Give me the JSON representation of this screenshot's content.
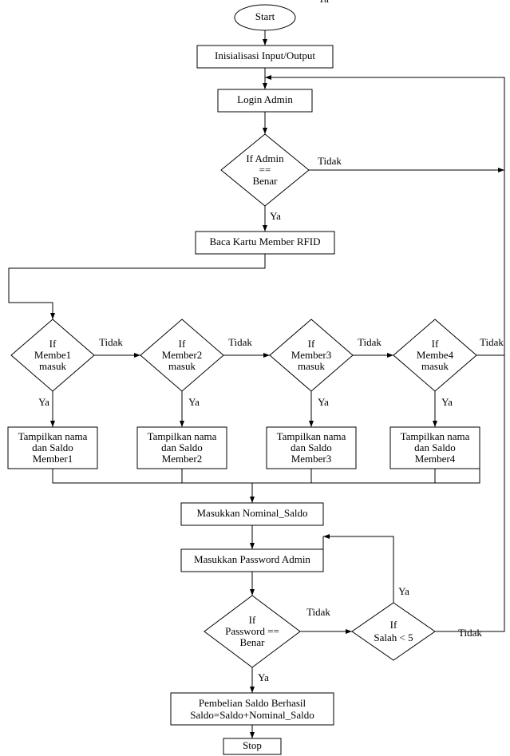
{
  "chart_data": {
    "type": "flowchart",
    "nodes": [
      {
        "id": "start",
        "type": "terminator",
        "label": "Start"
      },
      {
        "id": "init",
        "type": "process",
        "label": "Inisialisasi Input/Output"
      },
      {
        "id": "login",
        "type": "process",
        "label": "Login Admin"
      },
      {
        "id": "d_admin",
        "type": "decision",
        "label": "If Admin\n==\nBenar"
      },
      {
        "id": "rfid",
        "type": "process",
        "label": "Baca Kartu Member RFID"
      },
      {
        "id": "d_m1",
        "type": "decision",
        "label": "If\nMembe1\nmasuk"
      },
      {
        "id": "d_m2",
        "type": "decision",
        "label": "If\nMember2\nmasuk"
      },
      {
        "id": "d_m3",
        "type": "decision",
        "label": "If\nMember3\nmasuk"
      },
      {
        "id": "d_m4",
        "type": "decision",
        "label": "If\nMembe4\nmasuk"
      },
      {
        "id": "p_m1",
        "type": "process",
        "label": "Tampilkan nama\ndan Saldo\nMember1"
      },
      {
        "id": "p_m2",
        "type": "process",
        "label": "Tampilkan nama\ndan Saldo\nMember2"
      },
      {
        "id": "p_m3",
        "type": "process",
        "label": "Tampilkan nama\ndan Saldo\nMember3"
      },
      {
        "id": "p_m4",
        "type": "process",
        "label": "Tampilkan nama\ndan Saldo\nMember4"
      },
      {
        "id": "nominal",
        "type": "process",
        "label": "Masukkan  Nominal_Saldo"
      },
      {
        "id": "pwd",
        "type": "process",
        "label": "Masukkan Password Admin"
      },
      {
        "id": "d_pwd",
        "type": "decision",
        "label": "If\nPassword ==\nBenar"
      },
      {
        "id": "d_wrong",
        "type": "decision",
        "label": "If\nSalah < 5"
      },
      {
        "id": "success",
        "type": "process",
        "label": "Pembelian Saldo Berhasil\nSaldo=Saldo+Nominal_Saldo"
      },
      {
        "id": "stop",
        "type": "terminator",
        "label": "Stop"
      }
    ],
    "edges": [
      {
        "from": "start",
        "to": "init"
      },
      {
        "from": "init",
        "to": "login"
      },
      {
        "from": "login",
        "to": "d_admin"
      },
      {
        "from": "d_admin",
        "to": "rfid",
        "label": "Ya"
      },
      {
        "from": "d_admin",
        "to": "login",
        "label": "Tidak"
      },
      {
        "from": "rfid",
        "to": "d_m1"
      },
      {
        "from": "d_m1",
        "to": "p_m1",
        "label": "Ya"
      },
      {
        "from": "d_m1",
        "to": "d_m2",
        "label": "Tidak"
      },
      {
        "from": "d_m2",
        "to": "p_m2",
        "label": "Ya"
      },
      {
        "from": "d_m2",
        "to": "d_m3",
        "label": "Tidak"
      },
      {
        "from": "d_m3",
        "to": "p_m3",
        "label": "Ya"
      },
      {
        "from": "d_m3",
        "to": "d_m4",
        "label": "Tidak"
      },
      {
        "from": "d_m4",
        "to": "p_m4",
        "label": "Ya"
      },
      {
        "from": "d_m4",
        "to": "login",
        "label": "Tidak"
      },
      {
        "from": "p_m1",
        "to": "nominal"
      },
      {
        "from": "p_m2",
        "to": "nominal"
      },
      {
        "from": "p_m3",
        "to": "nominal"
      },
      {
        "from": "p_m4",
        "to": "nominal"
      },
      {
        "from": "nominal",
        "to": "pwd"
      },
      {
        "from": "pwd",
        "to": "d_pwd"
      },
      {
        "from": "d_pwd",
        "to": "success",
        "label": "Ya"
      },
      {
        "from": "d_pwd",
        "to": "d_wrong",
        "label": "Tidak"
      },
      {
        "from": "d_wrong",
        "to": "pwd",
        "label": "Ya"
      },
      {
        "from": "d_wrong",
        "to": "login",
        "label": "Tidak"
      },
      {
        "from": "success",
        "to": "stop"
      }
    ]
  },
  "labels": {
    "start": "Start",
    "init": "Inisialisasi Input/Output",
    "login": "Login Admin",
    "admin_l1": "If Admin",
    "admin_l2": "==",
    "admin_l3": "Benar",
    "rfid": "Baca Kartu Member RFID",
    "if": "If",
    "m1": "Membe1",
    "m2": "Member2",
    "m3": "Member3",
    "m4": "Membe4",
    "masuk": "masuk",
    "show1": "Tampilkan nama",
    "show2": "dan Saldo",
    "mem1": "Member1",
    "mem2": "Member2",
    "mem3": "Member3",
    "mem4": "Member4",
    "nominal": "Masukkan  Nominal_Saldo",
    "pwd": "Masukkan Password Admin",
    "pw_l1": "If",
    "pw_l2": "Password ==",
    "pw_l3": "Benar",
    "wr_l1": "If",
    "wr_l2": "Salah < 5",
    "succ1": "Pembelian Saldo Berhasil",
    "succ2": "Saldo=Saldo+Nominal_Saldo",
    "stop": "Stop",
    "ya": "Ya",
    "tidak": "Tidak"
  }
}
